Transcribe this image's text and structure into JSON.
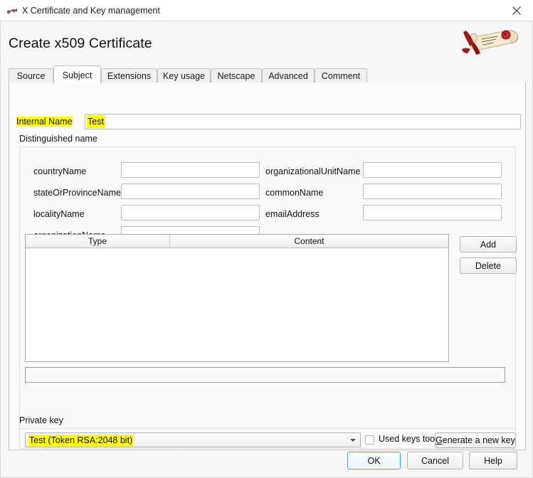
{
  "window": {
    "title": "X Certificate and Key management",
    "icon": "xca-key-icon",
    "close_label": "×"
  },
  "page": {
    "title": "Create x509 Certificate",
    "logo": "certificate-scroll-logo"
  },
  "tabs": [
    {
      "label": "Source",
      "active": false
    },
    {
      "label": "Subject",
      "active": true
    },
    {
      "label": "Extensions",
      "active": false
    },
    {
      "label": "Key usage",
      "active": false
    },
    {
      "label": "Netscape",
      "active": false
    },
    {
      "label": "Advanced",
      "active": false
    },
    {
      "label": "Comment",
      "active": false
    }
  ],
  "subject": {
    "internal_name": {
      "label": "Internal Name",
      "value": "Test",
      "placeholder": "",
      "highlighted": true
    },
    "distinguished_name": {
      "title": "Distinguished name",
      "fields_left": [
        {
          "label": "countryName",
          "value": "",
          "placeholder": ""
        },
        {
          "label": "stateOrProvinceName",
          "value": "",
          "placeholder": ""
        },
        {
          "label": "localityName",
          "value": "",
          "placeholder": ""
        },
        {
          "label": "organizationName",
          "value": "",
          "placeholder": ""
        }
      ],
      "fields_right": [
        {
          "label": "organizationalUnitName",
          "value": "",
          "placeholder": ""
        },
        {
          "label": "commonName",
          "value": "",
          "placeholder": ""
        },
        {
          "label": "emailAddress",
          "value": "",
          "placeholder": ""
        }
      ],
      "table": {
        "columns": [
          "Type",
          "Content"
        ],
        "rows": []
      },
      "side_buttons": [
        {
          "label": "Add"
        },
        {
          "label": "Delete"
        }
      ],
      "extra_field": {
        "value": "",
        "placeholder": ""
      }
    },
    "private_key": {
      "title": "Private key",
      "selected": "Test (Token RSA:2048 bit)",
      "selected_highlighted": true,
      "options": [
        "Test (Token RSA:2048 bit)"
      ],
      "used_keys_too": {
        "label": "Used keys too",
        "checked": false
      },
      "generate_button": {
        "mnemonic": "G",
        "rest": "enerate a new key",
        "label": "Generate a new key"
      }
    }
  },
  "dialog_buttons": [
    {
      "label": "OK",
      "default": true
    },
    {
      "label": "Cancel",
      "default": false
    },
    {
      "label": "Help",
      "default": false
    }
  ],
  "colors": {
    "highlight": "#ffff00",
    "window_bg": "#f6f6f6",
    "panel_bg": "#fbfbfb",
    "accent_focus": "#4aa3e0"
  }
}
